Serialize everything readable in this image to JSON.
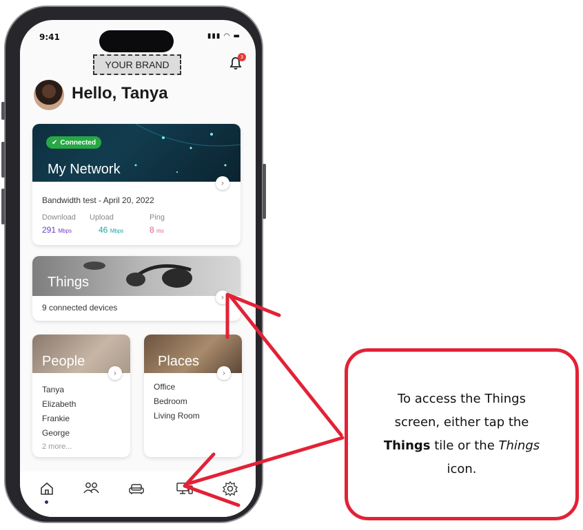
{
  "status": {
    "time": "9:41"
  },
  "brand": "YOUR BRAND",
  "notifications": {
    "count": "3"
  },
  "greeting": "Hello, Tanya",
  "network": {
    "status": "Connected",
    "title": "My Network",
    "test_label": "Bandwidth test - April 20, 2022",
    "download": {
      "label": "Download",
      "value": "291",
      "unit": "Mbps"
    },
    "upload": {
      "label": "Upload",
      "value": "46",
      "unit": "Mbps"
    },
    "ping": {
      "label": "Ping",
      "value": "8",
      "unit": "ms"
    }
  },
  "things": {
    "title": "Things",
    "subtitle": "9 connected devices"
  },
  "people": {
    "title": "People",
    "items": [
      "Tanya",
      "Elizabeth",
      "Frankie",
      "George"
    ],
    "more": "2 more..."
  },
  "places": {
    "title": "Places",
    "items": [
      "Office",
      "Bedroom",
      "Living Room"
    ]
  },
  "tabs": [
    "home-icon",
    "people-icon",
    "places-icon",
    "things-icon",
    "settings-icon"
  ],
  "callout": {
    "line1": "To access the Things",
    "line2": "screen, either tap the",
    "bold": "Things",
    "mid": " tile or the ",
    "italic": "Things",
    "line4": "icon."
  },
  "colors": {
    "accent": "#e22236",
    "download": "#6a3fc1",
    "upload": "#1aa6a0",
    "ping": "#e05a8a",
    "connected": "#27a844"
  }
}
